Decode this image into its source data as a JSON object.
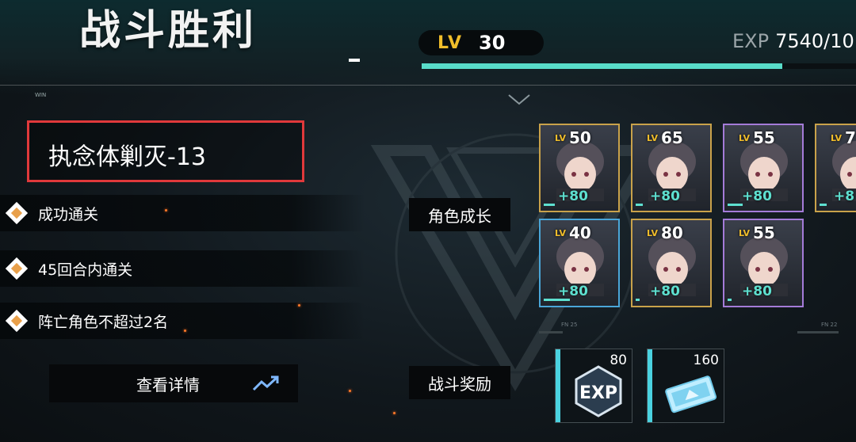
{
  "header": {
    "title": "战斗胜利",
    "win_label": "WIN"
  },
  "level": {
    "lv_label": "LV",
    "lv_value": "30",
    "exp_label": "EXP",
    "exp_value": "7540/10",
    "exp_progress_fraction": 0.83
  },
  "stage": {
    "name": "执念体剿灭-13"
  },
  "conditions": [
    {
      "label": "成功通关"
    },
    {
      "label": "45回合内通关"
    },
    {
      "label": "阵亡角色不超过2名"
    }
  ],
  "buttons": {
    "details": "查看详情"
  },
  "sections": {
    "growth": "角色成长",
    "rewards": "战斗奖励"
  },
  "characters": [
    {
      "lv_label": "LV",
      "level": "50",
      "exp_gain": "+80",
      "frame": "gold",
      "exp_fraction": 0.15
    },
    {
      "lv_label": "LV",
      "level": "65",
      "exp_gain": "+80",
      "frame": "gold",
      "exp_fraction": 0.1
    },
    {
      "lv_label": "LV",
      "level": "55",
      "exp_gain": "+80",
      "frame": "purple",
      "exp_fraction": 0.2
    },
    {
      "lv_label": "LV",
      "level": "7",
      "exp_gain": "+8",
      "frame": "gold",
      "exp_fraction": 0.1
    },
    {
      "lv_label": "LV",
      "level": "40",
      "exp_gain": "+80",
      "frame": "blue",
      "exp_fraction": 0.35
    },
    {
      "lv_label": "LV",
      "level": "80",
      "exp_gain": "+80",
      "frame": "gold",
      "exp_fraction": 0.05
    },
    {
      "lv_label": "LV",
      "level": "55",
      "exp_gain": "+80",
      "frame": "purple",
      "exp_fraction": 0.05
    }
  ],
  "rewards": [
    {
      "name": "EXP",
      "count": "80",
      "icon": "exp-badge-icon"
    },
    {
      "name": "ticket",
      "count": "160",
      "icon": "ticket-icon"
    }
  ],
  "colors": {
    "accent_gold": "#f0bd2a",
    "accent_teal": "#58dcc9",
    "stage_highlight": "#e0393b"
  }
}
